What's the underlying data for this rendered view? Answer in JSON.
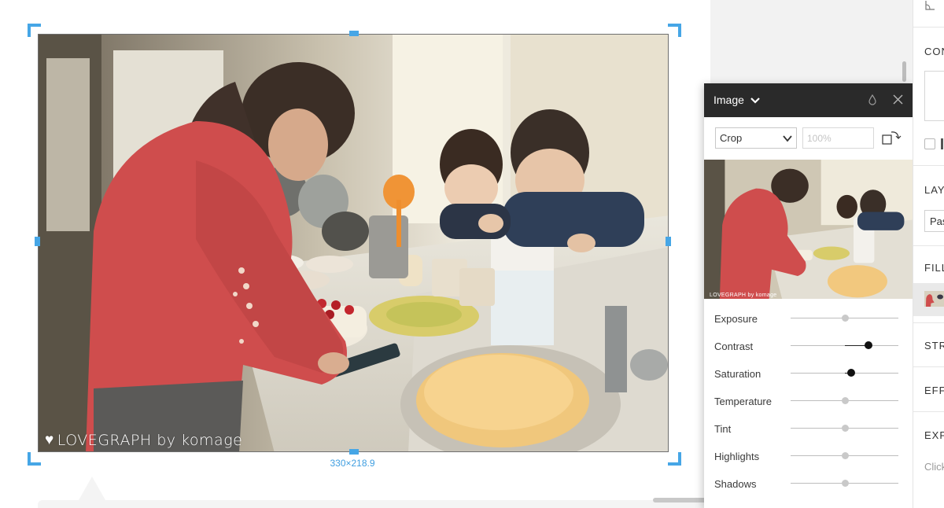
{
  "canvas": {
    "watermark": "LOVEGRAPH by komage",
    "dimensions": "330×218.9"
  },
  "image_panel": {
    "title": "Image",
    "crop_mode": "Crop",
    "zoom_placeholder": "100%",
    "thumbnail_watermark": "LOVEGRAPH by komage",
    "sliders": [
      {
        "label": "Exposure",
        "value": 0.5,
        "active": false
      },
      {
        "label": "Contrast",
        "value": 0.72,
        "active": true
      },
      {
        "label": "Saturation",
        "value": 0.56,
        "active": true
      },
      {
        "label": "Temperature",
        "value": 0.5,
        "active": false
      },
      {
        "label": "Tint",
        "value": 0.5,
        "active": false
      },
      {
        "label": "Highlights",
        "value": 0.5,
        "active": false
      },
      {
        "label": "Shadows",
        "value": 0.5,
        "active": false
      }
    ]
  },
  "inspector": {
    "sections": [
      "CON",
      "LAY",
      "FILL",
      "STR",
      "EFF",
      "EXP"
    ],
    "layer_blend_value": "Pas",
    "export_hint": "Click"
  },
  "colors": {
    "selection": "#46a6e6",
    "panel_header": "#2a2a2a"
  }
}
